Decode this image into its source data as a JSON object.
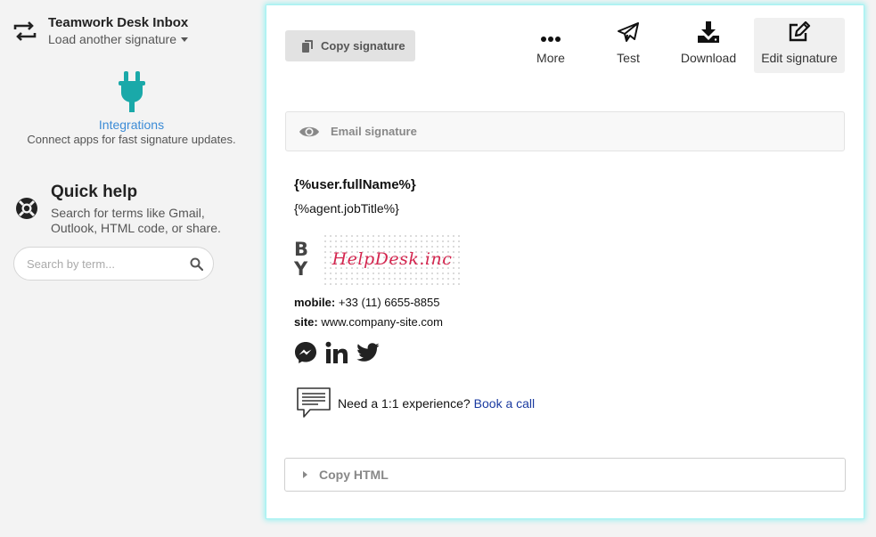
{
  "sidebar": {
    "signature_title": "Teamwork Desk Inbox",
    "signature_switch_label": "Load another signature",
    "integrations_label": "Integrations",
    "integrations_desc": "Connect apps for fast signature updates.",
    "quick_help_title": "Quick help",
    "quick_help_desc": "Search for terms like Gmail, Outlook, HTML code, or share.",
    "search_placeholder": "Search by term..."
  },
  "toolbar": {
    "copy_signature": "Copy signature",
    "more": "More",
    "test": "Test",
    "download": "Download",
    "edit_signature": "Edit signature"
  },
  "email_signature_label": "Email signature",
  "signature": {
    "name": "{%user.fullName%}",
    "job_title": "{%agent.jobTitle%}",
    "logo_letters": "B Y",
    "logo_brand": "HelpDesk.inc",
    "mobile_label": "mobile:",
    "mobile_value": "+33 (11) 6655-8855",
    "site_label": "site:",
    "site_value": "www.company-site.com",
    "social_icons": [
      "messenger-icon",
      "linkedin-icon",
      "twitter-icon"
    ],
    "cta_text": "Need a 1:1 experience?",
    "cta_link": "Book a call"
  },
  "copy_html_label": "Copy HTML",
  "colors": {
    "accent_teal": "#1aa9a9",
    "link_blue": "#3b8bd6",
    "brand_red": "#d4264f",
    "panel_glow": "#8ff0f0"
  }
}
